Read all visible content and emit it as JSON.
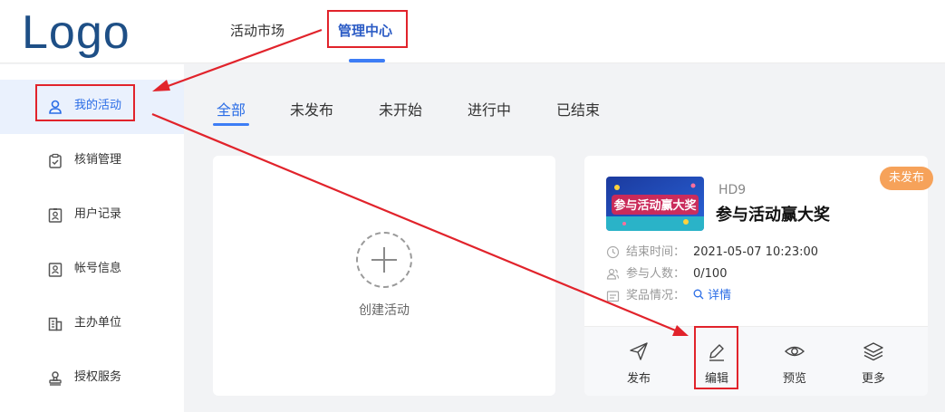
{
  "header": {
    "logo": "Logo",
    "nav": [
      "活动市场",
      "管理中心"
    ]
  },
  "sidebar": {
    "items": [
      {
        "label": "我的活动",
        "icon": "user-icon"
      },
      {
        "label": "核销管理",
        "icon": "clipboard-check-icon"
      },
      {
        "label": "用户记录",
        "icon": "id-card-icon"
      },
      {
        "label": "帐号信息",
        "icon": "account-card-icon"
      },
      {
        "label": "主办单位",
        "icon": "building-icon"
      },
      {
        "label": "授权服务",
        "icon": "seal-stamp-icon"
      }
    ]
  },
  "tabs": [
    "全部",
    "未发布",
    "未开始",
    "进行中",
    "已结束"
  ],
  "create_card": {
    "label": "创建活动"
  },
  "activity": {
    "code": "HD9",
    "title": "参与活动赢大奖",
    "status": "未发布",
    "banner_text": "参与活动赢大奖",
    "end_time_label": "结束时间：",
    "end_time": "2021-05-07 10:23:00",
    "participants_label": "参与人数：",
    "participants": "0/100",
    "prize_label": "奖品情况：",
    "detail_link": "详情",
    "actions": [
      {
        "label": "发布",
        "icon": "send-icon"
      },
      {
        "label": "编辑",
        "icon": "edit-pen-icon"
      },
      {
        "label": "预览",
        "icon": "eye-icon"
      },
      {
        "label": "更多",
        "icon": "layers-icon"
      }
    ]
  },
  "colors": {
    "primary": "#2b6de6",
    "brand": "#1e4f86",
    "annotation": "#e1232b",
    "badge": "#f6a25a"
  }
}
